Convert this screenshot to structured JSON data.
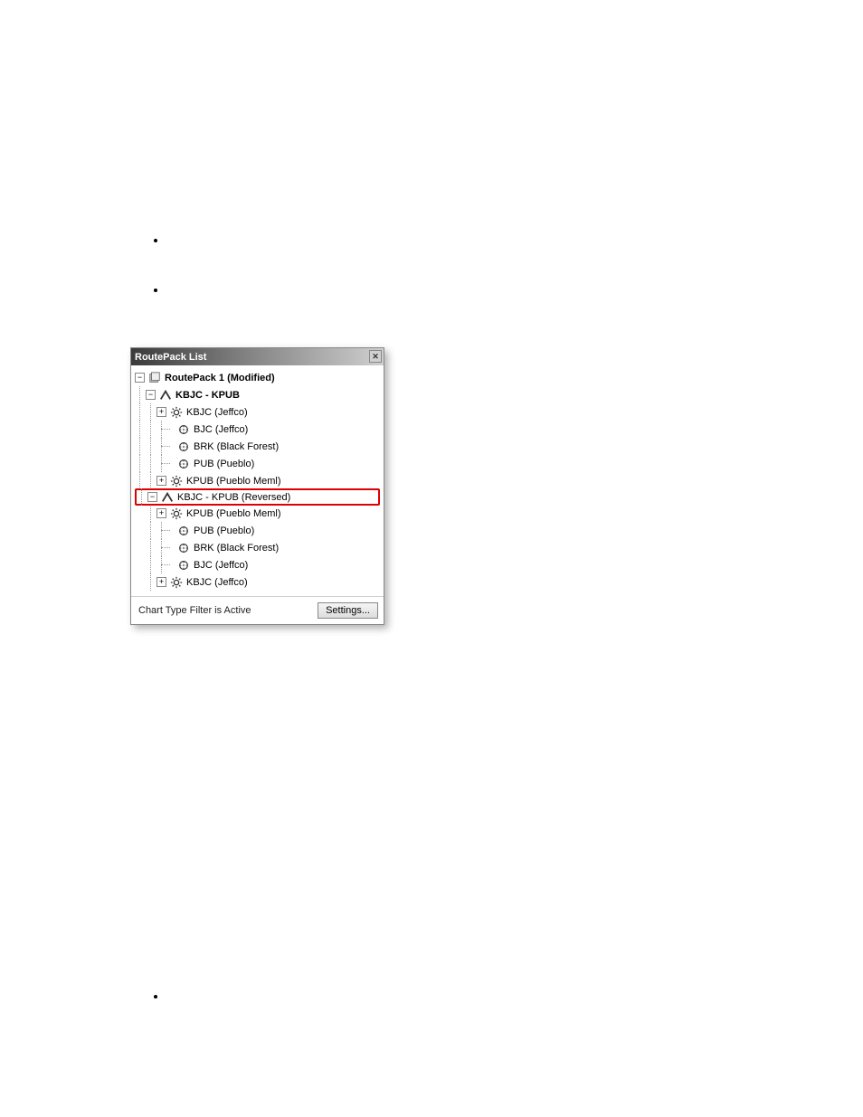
{
  "panel": {
    "title": "RoutePack List",
    "footer_status": "Chart Type Filter is Active",
    "settings_button": "Settings..."
  },
  "tree": {
    "root": {
      "label": "RoutePack 1 (Modified)",
      "expanded": true,
      "routes": [
        {
          "label": "KBJC - KPUB",
          "bold": true,
          "highlighted": false,
          "expanded": true,
          "children": [
            {
              "type": "airport",
              "label": "KBJC (Jeffco)",
              "expandable": true,
              "expanded": false
            },
            {
              "type": "waypoint",
              "label": "BJC (Jeffco)"
            },
            {
              "type": "waypoint",
              "label": "BRK (Black Forest)"
            },
            {
              "type": "waypoint",
              "label": "PUB (Pueblo)"
            },
            {
              "type": "airport",
              "label": "KPUB (Pueblo Meml)",
              "expandable": true,
              "expanded": false
            }
          ]
        },
        {
          "label": "KBJC - KPUB (Reversed)",
          "bold": false,
          "highlighted": true,
          "expanded": true,
          "children": [
            {
              "type": "airport",
              "label": "KPUB (Pueblo Meml)",
              "expandable": true,
              "expanded": false
            },
            {
              "type": "waypoint",
              "label": "PUB (Pueblo)"
            },
            {
              "type": "waypoint",
              "label": "BRK (Black Forest)"
            },
            {
              "type": "waypoint",
              "label": "BJC (Jeffco)"
            },
            {
              "type": "airport",
              "label": "KBJC (Jeffco)",
              "expandable": true,
              "expanded": false
            }
          ]
        }
      ]
    }
  },
  "bullets_top": [
    "",
    ""
  ],
  "bullets_bottom": [
    ""
  ]
}
